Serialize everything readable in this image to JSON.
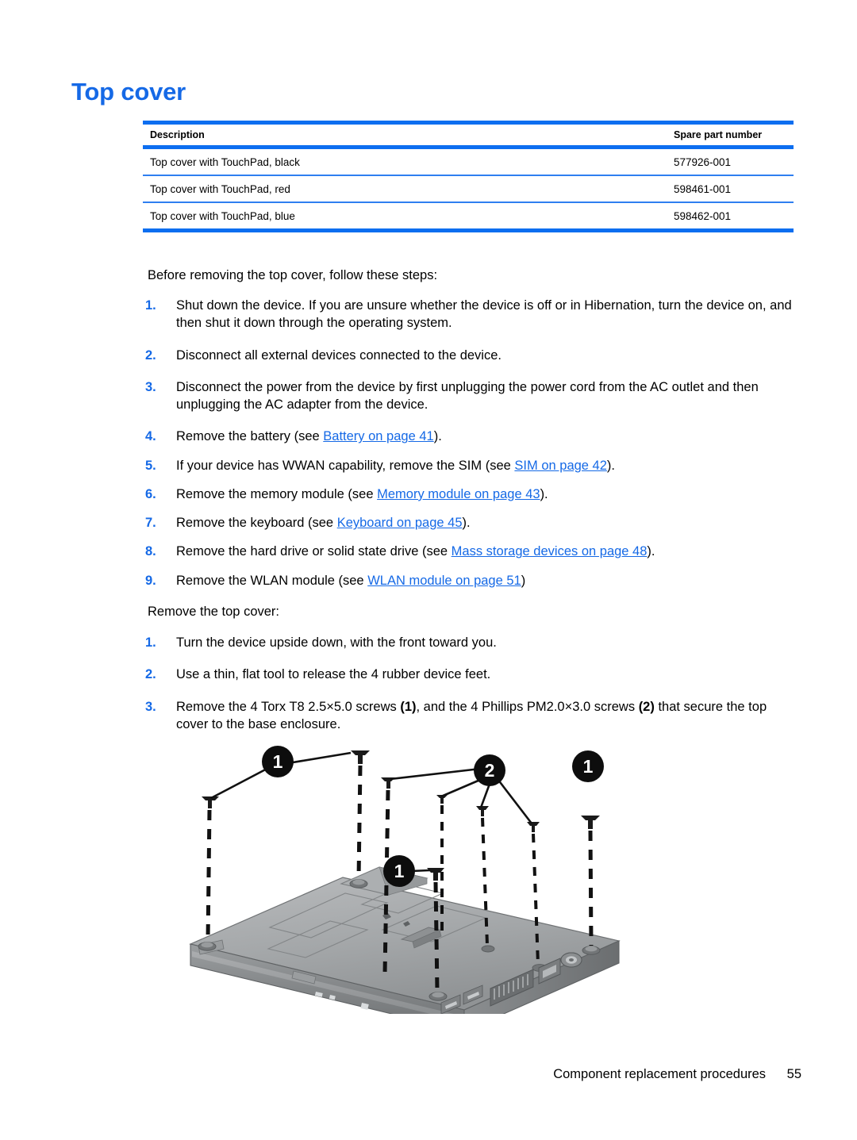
{
  "heading": "Top cover",
  "table": {
    "columns": [
      "Description",
      "Spare part number"
    ],
    "rows": [
      {
        "description": "Top cover with TouchPad, black",
        "part": "577926-001"
      },
      {
        "description": "Top cover with TouchPad, red",
        "part": "598461-001"
      },
      {
        "description": "Top cover with TouchPad, blue",
        "part": "598462-001"
      }
    ]
  },
  "intro": "Before removing the top cover, follow these steps:",
  "prep_steps": [
    {
      "num": "1.",
      "text": "Shut down the device. If you are unsure whether the device is off or in Hibernation, turn the device on, and then shut it down through the operating system."
    },
    {
      "num": "2.",
      "text": "Disconnect all external devices connected to the device."
    },
    {
      "num": "3.",
      "text": "Disconnect the power from the device by first unplugging the power cord from the AC outlet and then unplugging the AC adapter from the device."
    },
    {
      "num": "4.",
      "pre": "Remove the battery (see ",
      "link": "Battery on page 41",
      "post": ")."
    },
    {
      "num": "5.",
      "pre": "If your device has WWAN capability, remove the SIM (see ",
      "link": "SIM on page 42",
      "post": ")."
    },
    {
      "num": "6.",
      "pre": "Remove the memory module (see ",
      "link": "Memory module on page 43",
      "post": ")."
    },
    {
      "num": "7.",
      "pre": "Remove the keyboard (see ",
      "link": "Keyboard on page 45",
      "post": ")."
    },
    {
      "num": "8.",
      "pre": "Remove the hard drive or solid state drive (see ",
      "link": "Mass storage devices on page 48",
      "post": ")."
    },
    {
      "num": "9.",
      "pre": "Remove the WLAN module (see ",
      "link": "WLAN module on page 51",
      "post": ")"
    }
  ],
  "mid_note": "Remove the top cover:",
  "removal_steps": [
    {
      "num": "1.",
      "text": "Turn the device upside down, with the front toward you."
    },
    {
      "num": "2.",
      "text": "Use a thin, flat tool to release the 4 rubber device feet."
    },
    {
      "num": "3.",
      "seg1": "Remove the 4 Torx T8 2.5×5.0 screws ",
      "bold1": "(1)",
      "seg2": ", and the 4 Phillips PM2.0×3.0 screws ",
      "bold2": "(2)",
      "seg3": " that secure the top cover to the base enclosure."
    }
  ],
  "figure": {
    "alt": "Exploded view of device bottom showing Torx and Phillips screw locations",
    "callouts": [
      "1",
      "2",
      "1",
      "1"
    ]
  },
  "footer": {
    "title": "Component replacement procedures",
    "page": "55"
  },
  "colors": {
    "accent_blue": "#1569E6",
    "rule_blue": "#0d6ef0",
    "rule_thin_blue": "#2f7ff0"
  }
}
